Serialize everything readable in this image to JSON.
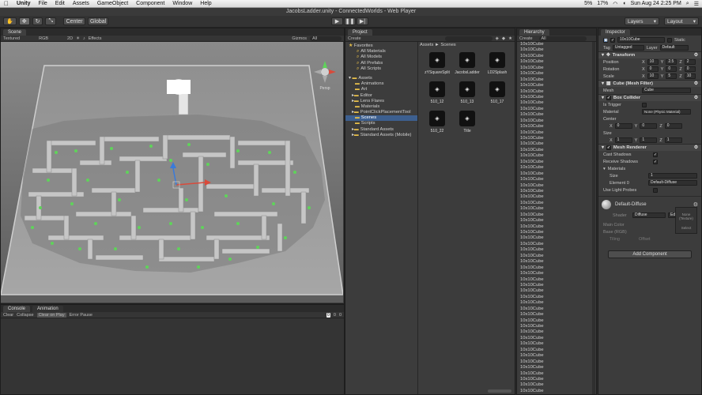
{
  "menubar": {
    "apple": "",
    "items": [
      "Unity",
      "File",
      "Edit",
      "Assets",
      "GameObject",
      "Component",
      "Window",
      "Help"
    ],
    "clock": "Sun Aug 24  2:25 PM",
    "battery": "17%",
    "cpu": "5%"
  },
  "window": {
    "title": "JacobsLadder.unity - ConnectedWorlds - Web Player"
  },
  "toolbar": {
    "pivot": "Center",
    "space": "Global",
    "layers": "Layers",
    "layout": "Layout"
  },
  "scene": {
    "tab": "Scene",
    "tab2": "Game",
    "render_mode": "Textured",
    "rgb": "RGB",
    "mode_2d": "2D",
    "effects": "Effects",
    "gizmos": "Gizmos",
    "search": "All",
    "persp": "Persp"
  },
  "console": {
    "tab": "Console",
    "tab2": "Animation",
    "buttons": [
      "Clear",
      "Collapse",
      "Clear on Play",
      "Error Pause"
    ],
    "counts": [
      "0",
      "0",
      "0"
    ]
  },
  "project": {
    "tab": "Project",
    "create": "Create",
    "favorites_label": "Favorites",
    "favorites": [
      "All Materials",
      "All Models",
      "All Prefabs",
      "All Scripts"
    ],
    "assets_label": "Assets",
    "folders": [
      "Animations",
      "Art",
      "Editor",
      "Lens Flares",
      "Materials",
      "PointClickPlacementTool",
      "Scenes",
      "Scripts",
      "Standard Assets",
      "Standard Assets (Mobile)"
    ],
    "breadcrumb": "Assets ► Scenes",
    "scene_files": [
      "zYSquareSplit",
      "JacobsLadder",
      "LD2Splash",
      "510_12",
      "510_13",
      "510_17",
      "510_22",
      "Title"
    ]
  },
  "hierarchy": {
    "tab": "Hierarchy",
    "create": "Create",
    "search": "All",
    "rows": [
      "10x10Cube",
      "10x10Cube",
      "10x10Cube",
      "10x10Cube",
      "10x10Cube",
      "10x10Cube",
      "10x10Cube",
      "10x10Cube",
      "10x10Cube",
      "10x10Cube",
      "10x10Cube",
      "10x10Cube",
      "10x10Cube",
      "10x10Cube",
      "10x10Cube",
      "10x10Cube",
      "10x10Cube",
      "10x10Cube",
      "10x10Cube",
      "10x10Cube",
      "10x10Cube",
      "10x10Cube",
      "10x10Cube",
      "10x10Cube",
      "10x10Cube",
      "10x10Cube",
      "10x10Cube",
      "10x10Cube",
      "10x10Cube",
      "10x10Cube",
      "10x10Cube",
      "10x10Cube",
      "10x10Cube",
      "10x10Cube",
      "10x10Cube",
      "10x10Cube",
      "10x10Cube",
      "10x10Cube",
      "10x10Cube",
      "10x10Cube",
      "10x10Cube",
      "10x10Cube",
      "10x10Cube",
      "10x10Cube",
      "10x10Cube",
      "10x10Cube",
      "10x10Cube",
      "10x10Cube",
      "10x10Cube",
      "10x10Cube",
      "10x10Cube",
      "10x10Cube",
      "10x10Cube",
      "10x10Cube",
      "10x10Cube",
      "10x10Cube",
      "10x10Cube",
      "10x10Cube",
      "10x10Cube",
      "10x10Cube"
    ]
  },
  "inspector": {
    "tab": "Inspector",
    "object_name": "10x10Cube",
    "static": "Static",
    "tag_label": "Tag",
    "tag": "Untagged",
    "layer_label": "Layer",
    "layer": "Default",
    "transform": {
      "title": "Transform",
      "position_label": "Position",
      "position": [
        "10",
        "2.5",
        "2"
      ],
      "rotation_label": "Rotation",
      "rotation": [
        "0",
        "0",
        "0"
      ],
      "scale_label": "Scale",
      "scale": [
        "10",
        "5",
        "10"
      ]
    },
    "mesh_filter": {
      "title": "Cube (Mesh Filter)",
      "mesh_label": "Mesh",
      "mesh": "Cube"
    },
    "box_collider": {
      "title": "Box Collider",
      "is_trigger": "Is Trigger",
      "material_label": "Material",
      "material": "None (Physic Material)",
      "center_label": "Center",
      "center": [
        "0",
        "0",
        "0"
      ],
      "size_label": "Size",
      "size": [
        "1",
        "1",
        "1"
      ]
    },
    "mesh_renderer": {
      "title": "Mesh Renderer",
      "cast": "Cast Shadows",
      "receive": "Receive Shadows",
      "materials": "Materials",
      "size_label": "Size",
      "size": "1",
      "element_label": "Element 0",
      "element": "Default-Diffuse",
      "light_probes": "Use Light Probes"
    },
    "material": {
      "name": "Default-Diffuse",
      "shader_label": "Shader",
      "shader": "Diffuse",
      "edit": "Edit...",
      "main_color": "Main Color",
      "base": "Base (RGB)",
      "tiling": "Tiling",
      "offset": "Offset",
      "none_texture": "None (Texture)",
      "select": "Select"
    },
    "add_component": "Add Component"
  },
  "colors": {
    "accent": "#3d5f8f",
    "panel": "#3c3c3c",
    "scene_bg": "#6e6e6e",
    "green_markers": "#5fd35a"
  }
}
